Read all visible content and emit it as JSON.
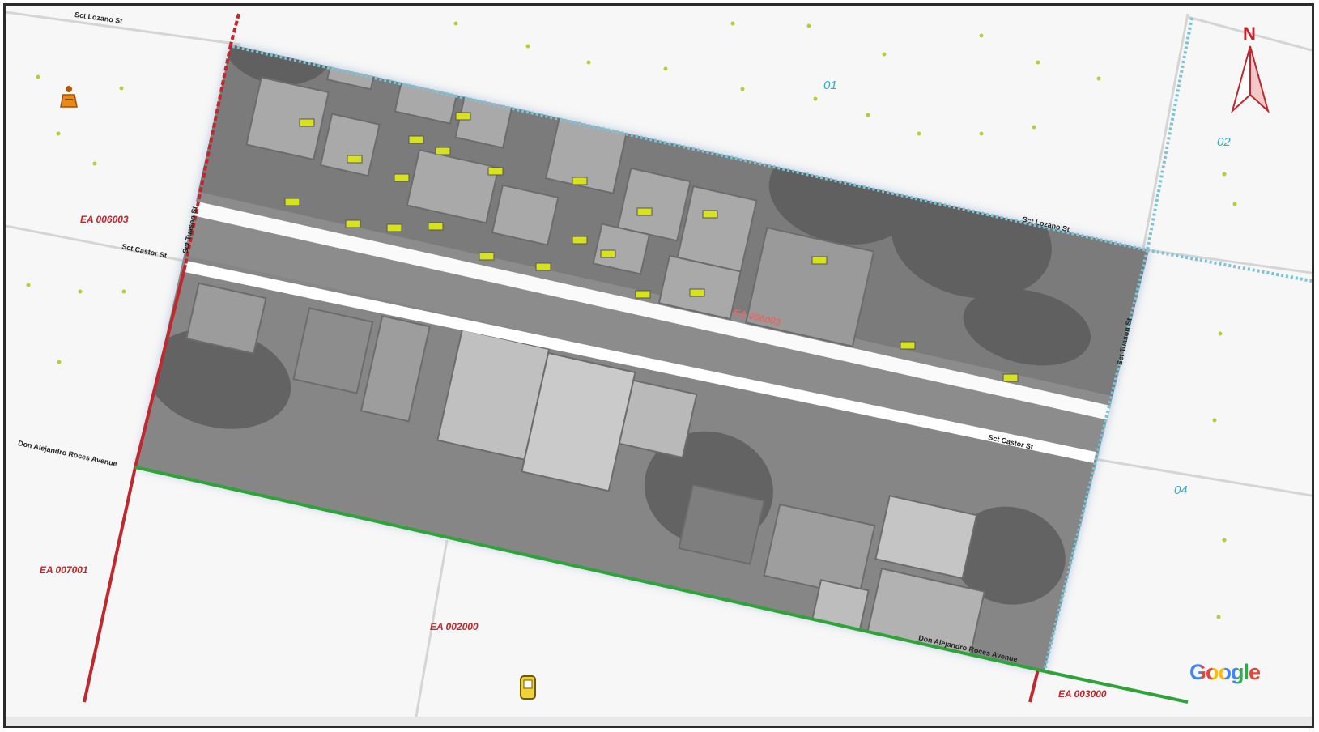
{
  "map": {
    "ea_labels": [
      "EA 006003",
      "EA 006003",
      "EA 007001",
      "EA 002000",
      "EA 003000"
    ],
    "block_labels": [
      "01",
      "02",
      "04"
    ],
    "street_labels": [
      "Sct Lozano St",
      "Sct Castor St",
      "Sct Tuason St",
      "Sct Castor St",
      "Sct Lozano St",
      "Sct Tuason St",
      "Don Alejandro Roces Avenue",
      "Don Alejandro Roces Avenue"
    ],
    "google_logo": "Google",
    "north_label": "N",
    "icons": [
      "capture-point-icon",
      "gps-marker-icon",
      "north-arrow-icon"
    ],
    "colors": {
      "ea_boundary_red": "#c0282d",
      "ea_boundary_green": "#2fa33a",
      "block_boundary_blue": "#7cc3d8",
      "structure_point": "#d7e21d",
      "dot": "#b7cc3a"
    }
  }
}
